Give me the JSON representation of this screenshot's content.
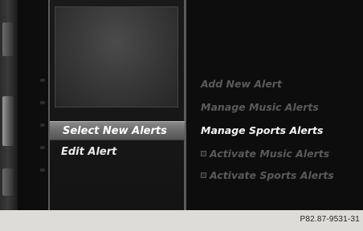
{
  "center_menu": {
    "items": [
      {
        "label": "Select New Alerts",
        "selected": true
      },
      {
        "label": "Edit Alert",
        "selected": false
      }
    ]
  },
  "right_menu": {
    "items": [
      {
        "label": "Add New Alert",
        "state": "disabled"
      },
      {
        "label": "Manage Music Alerts",
        "state": "disabled"
      },
      {
        "label": "Manage Sports Alerts",
        "state": "active"
      },
      {
        "label": "Activate Music Alerts",
        "state": "disabled",
        "icon": "checkbox-icon"
      },
      {
        "label": "Activate Sports Alerts",
        "state": "disabled",
        "icon": "checkbox-icon"
      }
    ]
  },
  "footer": {
    "ref_code": "P82.87-9531-31"
  },
  "colors": {
    "screen_bg": "#0b0b0b",
    "highlight": "#7a7a7a",
    "active_text": "#f4f4f4",
    "disabled_text": "#5a5a5a",
    "page_bg": "#dedcd8"
  }
}
